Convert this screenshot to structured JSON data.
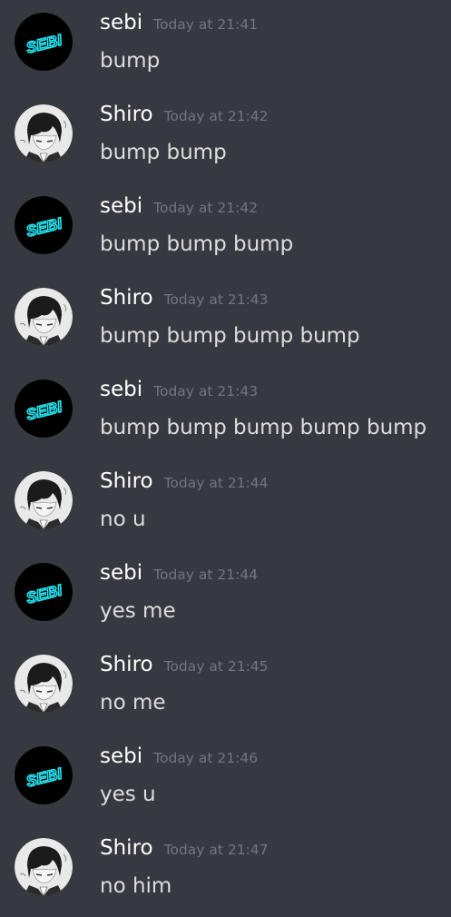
{
  "messages": [
    {
      "author": "sebi",
      "avatar": "sebi-neon-avatar",
      "timestamp": "Today at 21:41",
      "text": "bump"
    },
    {
      "author": "Shiro",
      "avatar": "shiro-anime-avatar",
      "timestamp": "Today at 21:42",
      "text": "bump bump"
    },
    {
      "author": "sebi",
      "avatar": "sebi-neon-avatar",
      "timestamp": "Today at 21:42",
      "text": "bump bump bump"
    },
    {
      "author": "Shiro",
      "avatar": "shiro-anime-avatar",
      "timestamp": "Today at 21:43",
      "text": "bump bump bump bump"
    },
    {
      "author": "sebi",
      "avatar": "sebi-neon-avatar",
      "timestamp": "Today at 21:43",
      "text": "bump bump bump bump bump"
    },
    {
      "author": "Shiro",
      "avatar": "shiro-anime-avatar",
      "timestamp": "Today at 21:44",
      "text": "no u"
    },
    {
      "author": "sebi",
      "avatar": "sebi-neon-avatar",
      "timestamp": "Today at 21:44",
      "text": "yes me"
    },
    {
      "author": "Shiro",
      "avatar": "shiro-anime-avatar",
      "timestamp": "Today at 21:45",
      "text": "no me"
    },
    {
      "author": "sebi",
      "avatar": "sebi-neon-avatar",
      "timestamp": "Today at 21:46",
      "text": "yes u"
    },
    {
      "author": "Shiro",
      "avatar": "shiro-anime-avatar",
      "timestamp": "Today at 21:47",
      "text": "no him"
    }
  ],
  "avatar_logo_text": "SEBI",
  "colors": {
    "background": "#36393f",
    "username": "#ffffff",
    "timestamp": "#72767d",
    "message_text": "#dcddde",
    "sebi_avatar_bg": "#000000",
    "sebi_neon": "#22e6f2"
  }
}
